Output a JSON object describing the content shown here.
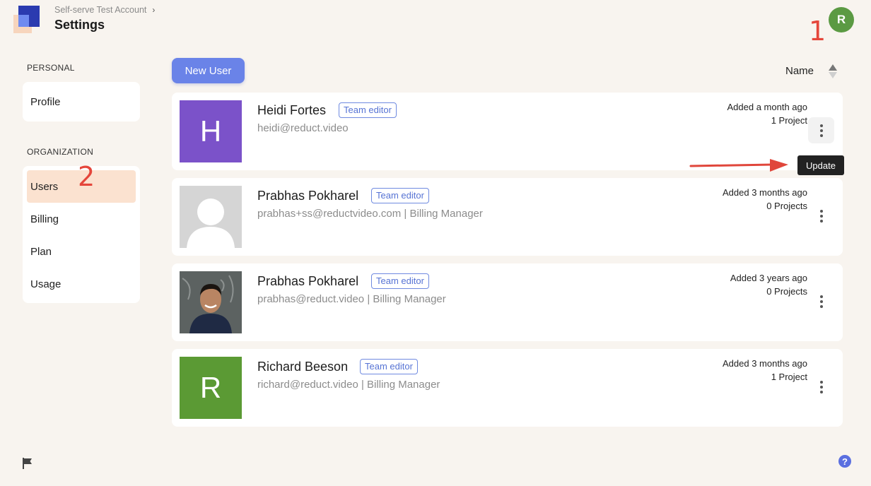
{
  "header": {
    "breadcrumb": "Self-serve Test Account",
    "title": "Settings",
    "avatar_initial": "R",
    "avatar_color": "#5b9a43"
  },
  "annotations": {
    "marker_1": "1",
    "marker_2": "2"
  },
  "sidebar": {
    "personal_label": "PERSONAL",
    "personal_items": [
      {
        "label": "Profile"
      }
    ],
    "org_label": "ORGANIZATION",
    "org_items": [
      {
        "label": "Users",
        "active": true
      },
      {
        "label": "Billing"
      },
      {
        "label": "Plan"
      },
      {
        "label": "Usage"
      }
    ]
  },
  "toolbar": {
    "new_user_label": "New User",
    "sort_label": "Name"
  },
  "users": [
    {
      "name": "Heidi Fortes",
      "role": "Team editor",
      "email": "heidi@reduct.video",
      "added": "Added a month ago",
      "projects": "1 Project",
      "avatar": "H",
      "avatar_color": "#7b52c9"
    },
    {
      "name": "Prabhas Pokharel",
      "role": "Team editor",
      "email": "prabhas+ss@reductvideo.com | Billing Manager",
      "added": "Added 3 months ago",
      "projects": "0 Projects",
      "avatar": "placeholder"
    },
    {
      "name": "Prabhas Pokharel",
      "role": "Team editor",
      "email": "prabhas@reduct.video | Billing Manager",
      "added": "Added 3 years ago",
      "projects": "0 Projects",
      "avatar": "photo"
    },
    {
      "name": "Richard Beeson",
      "role": "Team editor",
      "email": "richard@reduct.video | Billing Manager",
      "added": "Added 3 months ago",
      "projects": "1 Project",
      "avatar": "R",
      "avatar_color": "#5b9a34"
    }
  ],
  "tooltip": "Update",
  "footer": {
    "help_glyph": "?"
  },
  "colors": {
    "accent": "#6a83e8",
    "active_nav": "#fbe2d0",
    "annotation": "#e5463b"
  }
}
